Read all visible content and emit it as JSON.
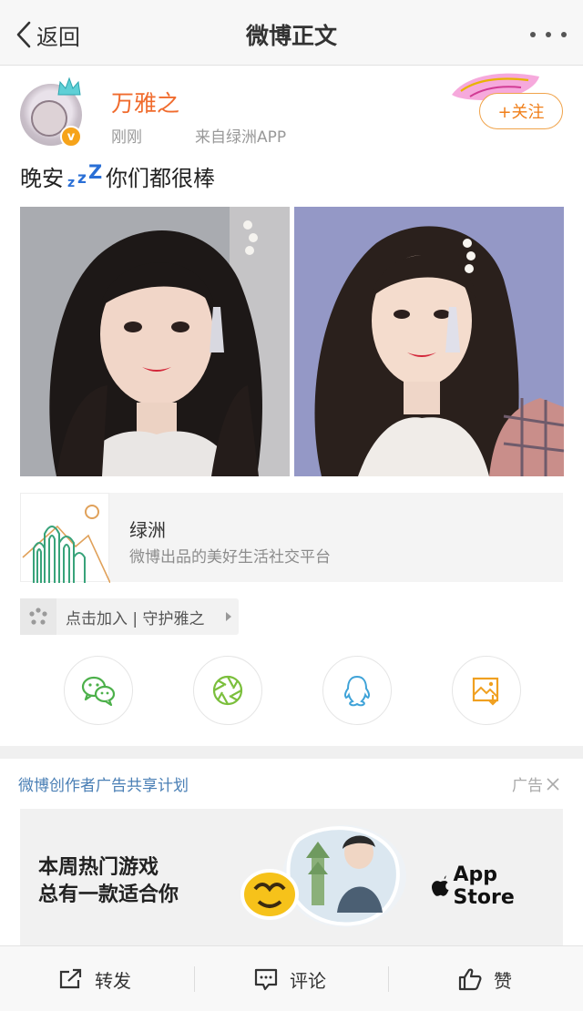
{
  "nav": {
    "back_label": "返回",
    "title": "微博正文"
  },
  "post": {
    "username": "万雅之",
    "verified_mark": "v",
    "time": "刚刚",
    "source": "来自绿洲APP",
    "follow_label": "+关注",
    "text_before": "晚安",
    "text_after": "你们都很棒",
    "photo_count": 2
  },
  "app_card": {
    "name": "绿洲",
    "description": "微博出品的美好生活社交平台"
  },
  "group_chip": {
    "label": "点击加入 | 守护雅之"
  },
  "share": {
    "icons": [
      "wechat-icon",
      "moments-icon",
      "qq-icon",
      "save-image-icon"
    ]
  },
  "ad": {
    "title": "微博创作者广告共享计划",
    "tag": "广告",
    "headline_line1": "本周热门游戏",
    "headline_line2": "总有一款适合你",
    "store_label": "App Store"
  },
  "bottom_bar": {
    "repost": "转发",
    "comment": "评论",
    "like": "赞"
  },
  "colors": {
    "username": "#f06b2d",
    "follow": "#f07f1a",
    "link_blue": "#4a7fb5",
    "verified_badge": "#f6a31a"
  }
}
